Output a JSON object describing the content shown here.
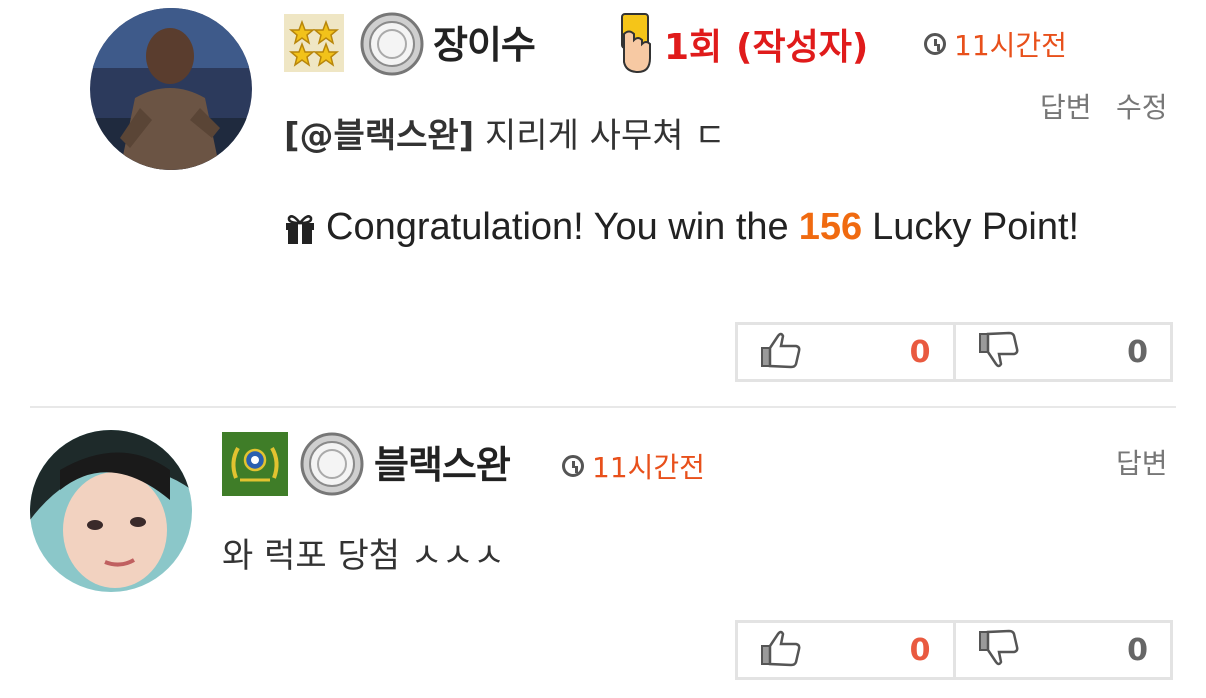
{
  "comments": [
    {
      "author": "장이수",
      "count_badge": "1회",
      "author_tag": "(작성자)",
      "time": "11시간전",
      "actions": [
        "답변",
        "수정"
      ],
      "mention": "[@블랙스완]",
      "text": "지리게 사무쳐 ㄷ",
      "lucky": {
        "prefix": "Congratulation! You win the",
        "points": "156",
        "suffix": "Lucky Point!"
      },
      "votes": {
        "up": "0",
        "down": "0"
      }
    },
    {
      "author": "블랙스완",
      "time": "11시간전",
      "actions": [
        "답변"
      ],
      "text": "와 럭포 당첨 ㅅㅅㅅ",
      "votes": {
        "up": "0",
        "down": "0"
      }
    }
  ],
  "colors": {
    "accent": "#e8501b",
    "vote_up": "#e95a40",
    "vote_border": "#e3e3e3"
  }
}
